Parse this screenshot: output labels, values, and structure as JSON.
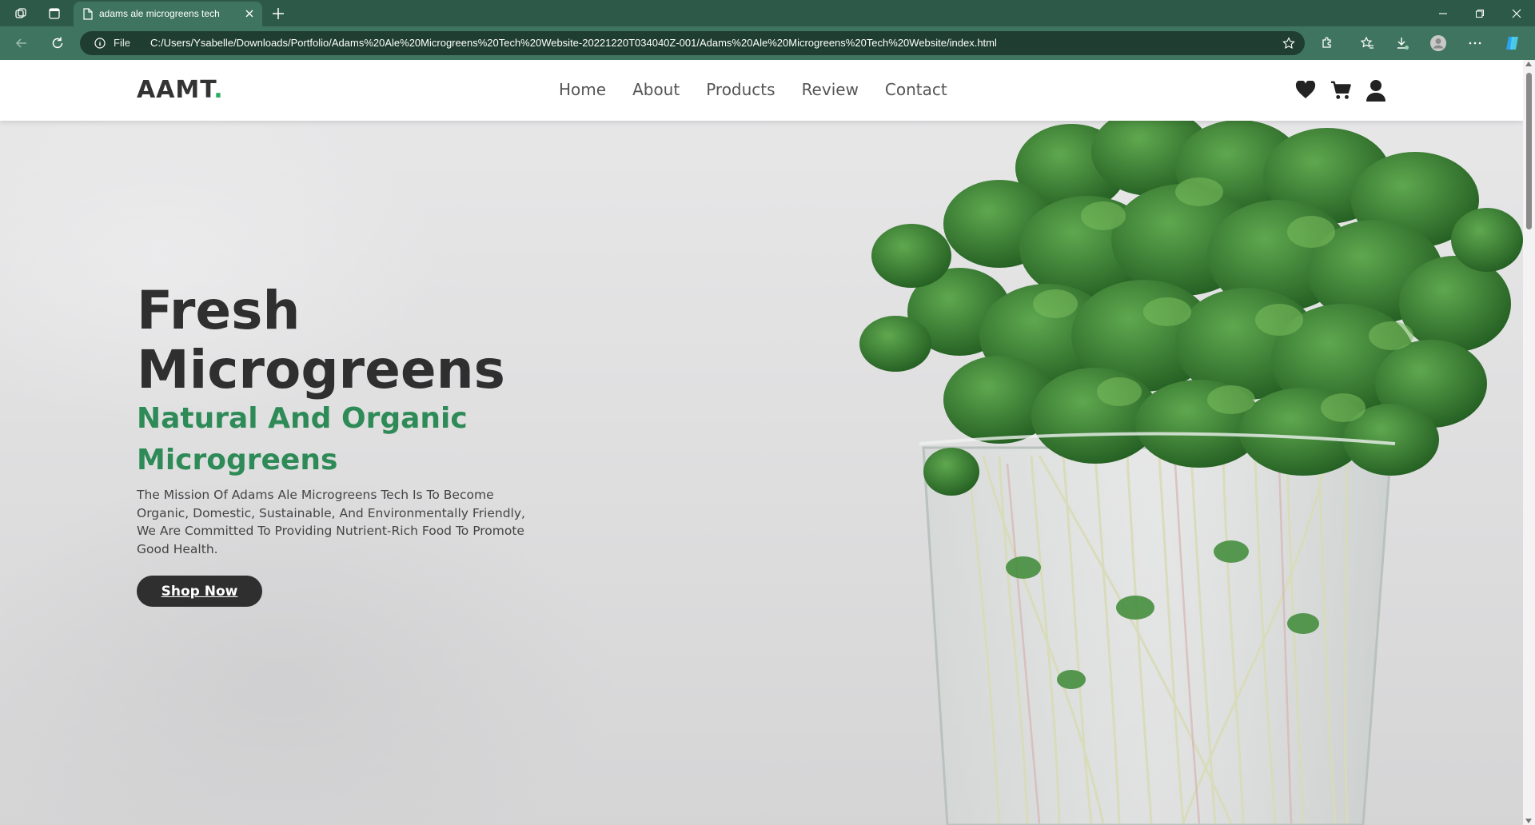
{
  "browser": {
    "tab_title": "adams ale microgreens tech",
    "address_prefix": "File",
    "url": "C:/Users/Ysabelle/Downloads/Portfolio/Adams%20Ale%20Microgreens%20Tech%20Website-20221220T034040Z-001/Adams%20Ale%20Microgreens%20Tech%20Website/index.html",
    "theme_color": "#3f7560"
  },
  "site": {
    "logo_text": "AAMT",
    "logo_dot": ".",
    "accent_color": "#27ae60",
    "nav": [
      {
        "label": "Home"
      },
      {
        "label": "About"
      },
      {
        "label": "Products"
      },
      {
        "label": "Review"
      },
      {
        "label": "Contact"
      }
    ],
    "icons": [
      "heart-icon",
      "cart-icon",
      "user-icon"
    ]
  },
  "hero": {
    "title": "Fresh Microgreens",
    "subtitle": "Natural And Organic Microgreens",
    "description": "The Mission Of Adams Ale Microgreens Tech Is To Become Organic, Domestic, Sustainable, And Environmentally Friendly, We Are Committed To Providing Nutrient-Rich Food To Promote Good Health.",
    "cta_label": "Shop Now"
  }
}
